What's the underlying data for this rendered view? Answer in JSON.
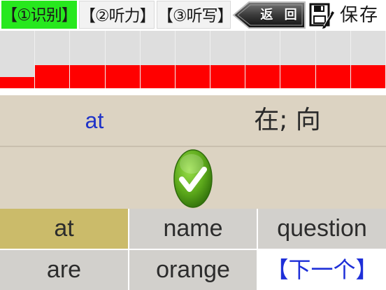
{
  "toolbar": {
    "tabs": [
      {
        "label": "【①识别】",
        "active": true
      },
      {
        "label": "【②听力】",
        "active": false
      },
      {
        "label": "【③听写】",
        "active": false
      }
    ],
    "back_label": "返 回",
    "save_label": "保存"
  },
  "progress": {
    "cells": 11,
    "first_cell_fill_percent": 20,
    "other_cells_fill_percent": 40
  },
  "word": {
    "english": "at",
    "chinese": "在; 向"
  },
  "result": {
    "status": "correct"
  },
  "options": [
    {
      "label": "at",
      "selected": true
    },
    {
      "label": "name",
      "selected": false
    },
    {
      "label": "question",
      "selected": false
    },
    {
      "label": "are",
      "selected": false
    },
    {
      "label": "orange",
      "selected": false
    }
  ],
  "next_label": "【下一个】",
  "colors": {
    "active_tab": "#27e81e",
    "progress_fill": "#ff0000",
    "english_word": "#1f33c8",
    "selected_option": "#cbbb6a",
    "next_text": "#1e2fd8",
    "check_green": "#5aa61a"
  }
}
